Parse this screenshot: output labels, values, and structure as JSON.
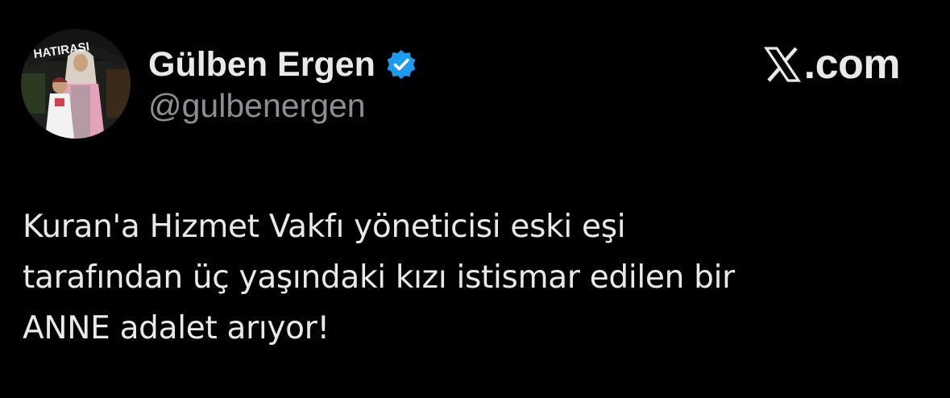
{
  "author": {
    "display_name": "Gülben Ergen",
    "handle": "@gulbenergen",
    "verified": true,
    "avatar_banner_text": "HATIRASI"
  },
  "brand": {
    "icon": "x-logo-icon",
    "text": ".com"
  },
  "tweet": {
    "lines": [
      "Kuran'a Hizmet Vakfı yöneticisi eski eşi",
      "tarafından üç yaşındaki kızı istismar edilen bir",
      "ANNE adalet arıyor!"
    ]
  },
  "colors": {
    "background": "#000000",
    "text_primary": "#e7e9ea",
    "text_secondary": "#8b8f94",
    "verified_badge": "#1d9bf0"
  }
}
